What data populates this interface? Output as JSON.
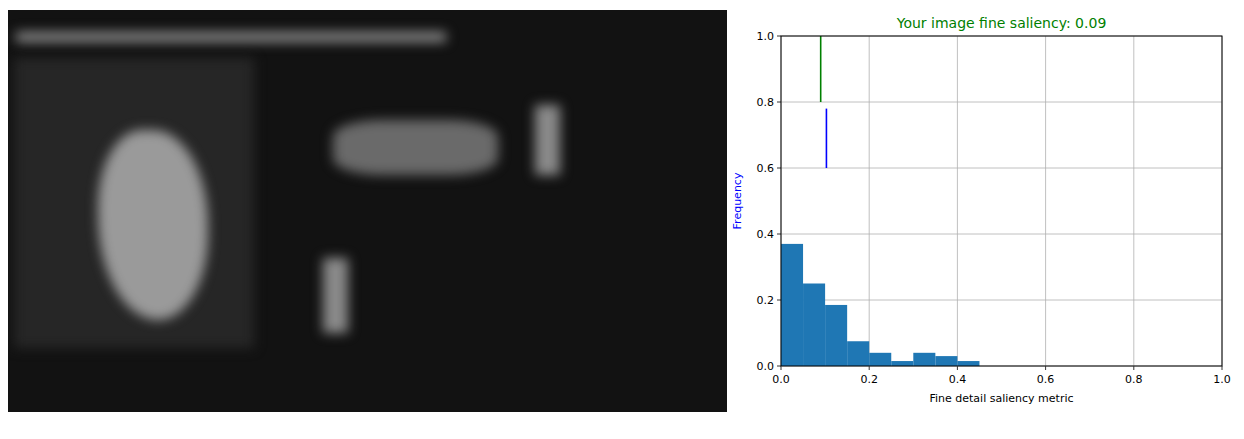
{
  "chart": {
    "title": "Your image fine saliency: 0.09",
    "x_label": "Fine detail saliency metric",
    "y_label": "Frequency",
    "x_ticks": [
      "0.0",
      "0.2",
      "0.4",
      "0.6",
      "0.8",
      "1.0"
    ],
    "y_ticks": [
      "0.0",
      "0.2",
      "0.4",
      "0.6",
      "0.8",
      "1.0"
    ],
    "bin_start": 0,
    "bin_width": 0.05,
    "series": [
      {
        "name": "histogram",
        "values": [
          0.37,
          0.25,
          0.185,
          0.075,
          0.04,
          0.015,
          0.04,
          0.03,
          0.015,
          0,
          0,
          0,
          0,
          0,
          0,
          0,
          0,
          0,
          0,
          0
        ]
      }
    ],
    "markers": [
      {
        "x": 0.09,
        "from": 0.8,
        "to": 1.0,
        "color": "#008000"
      },
      {
        "x": 0.103,
        "from": 0.6,
        "to": 0.78,
        "color": "#0000ff"
      }
    ]
  }
}
